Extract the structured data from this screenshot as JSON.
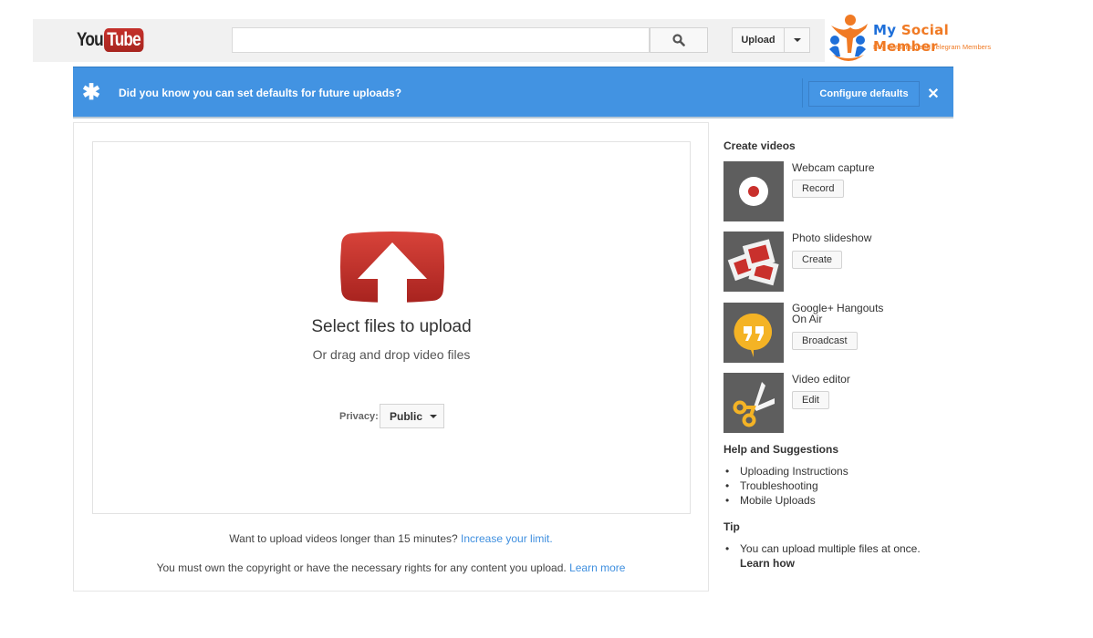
{
  "header": {
    "logo_you": "You",
    "logo_tube": "Tube",
    "search": {
      "value": "",
      "placeholder": ""
    },
    "search_icon": "search-icon",
    "upload_label": "Upload",
    "upload_menu_icon": "caret-down-icon"
  },
  "watermark": {
    "name_part1": "My ",
    "name_part2": "Social",
    "name_part3": " Member",
    "tagline": "Buy Instagram and Telegram Members"
  },
  "banner": {
    "icon": "asterisk-icon",
    "text": "Did you know you can set defaults for future uploads?",
    "configure_label": "Configure defaults",
    "close_label": "✕",
    "color": "#4293e2"
  },
  "upload": {
    "title": "Select files to upload",
    "subtitle": "Or drag and drop video files",
    "privacy_label": "Privacy:",
    "privacy_value": "Public",
    "icon_color": "#c4302b"
  },
  "footer": {
    "limit_text": "Want to upload videos longer than 15 minutes? ",
    "limit_link": "Increase your limit.",
    "rights_text": "You must own the copyright or have the necessary rights for any content you upload. ",
    "rights_link": "Learn more",
    "link_color": "#3f8fdf"
  },
  "sidebar": {
    "create_heading": "Create videos",
    "create_items": [
      {
        "title": "Webcam capture",
        "button": "Record",
        "icon": "webcam-record-icon"
      },
      {
        "title": "Photo slideshow",
        "button": "Create",
        "icon": "photo-slideshow-icon"
      },
      {
        "title_line1": "Google+ Hangouts",
        "title_line2": "On Air",
        "button": "Broadcast",
        "icon": "hangouts-icon"
      },
      {
        "title": "Video editor",
        "button": "Edit",
        "icon": "scissors-icon"
      }
    ],
    "help_heading": "Help and Suggestions",
    "help_links": [
      "Uploading Instructions",
      "Troubleshooting",
      "Mobile Uploads"
    ],
    "tip_heading": "Tip",
    "tip_text": "You can upload multiple files at once.",
    "tip_link": "Learn how"
  }
}
